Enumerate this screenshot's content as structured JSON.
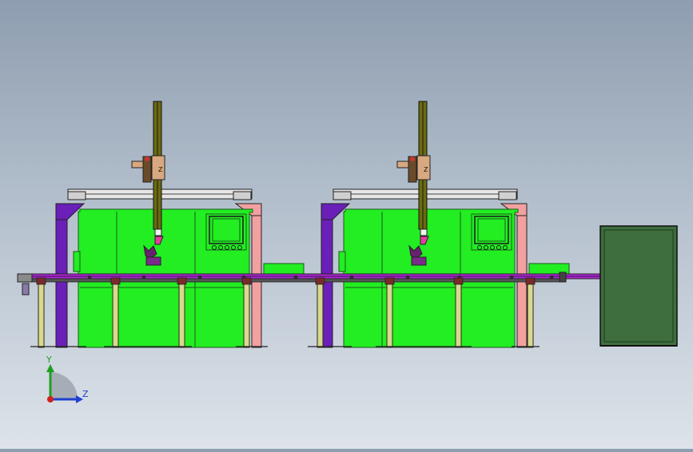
{
  "triad": {
    "y_label": "Y",
    "z_label": "Z"
  },
  "colors": {
    "machine_body": "#22ee22",
    "frame_purple": "#6a1fb8",
    "frame_pink": "#f2a0a0",
    "conveyor_purple": "#b02ad8",
    "leg_olive": "#6b6b10",
    "bin_green": "#3e6e3e",
    "carriage_tan": "#d8a880"
  }
}
